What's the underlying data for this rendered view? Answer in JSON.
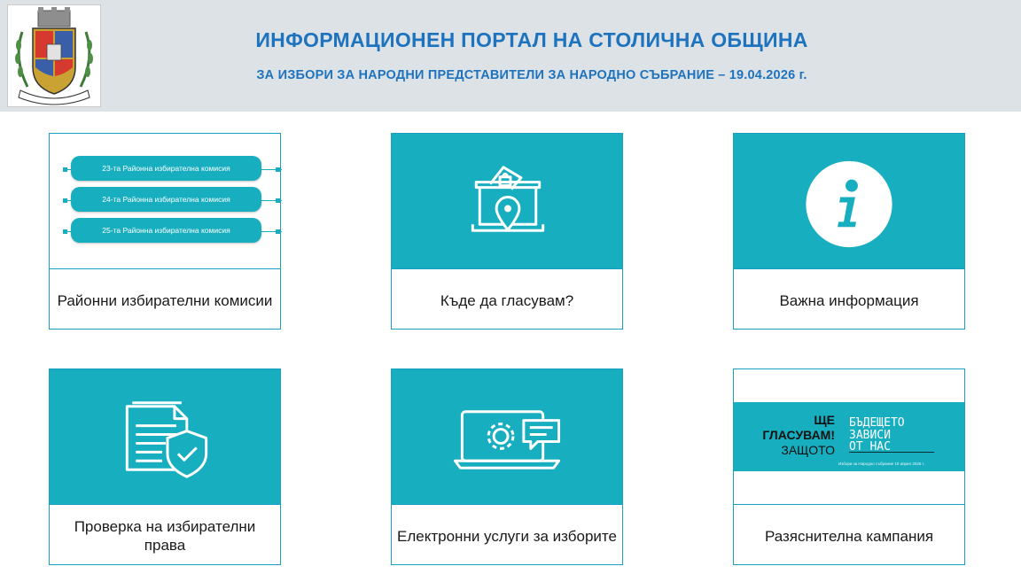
{
  "header": {
    "title": "ИНФОРМАЦИОНЕН ПОРТАЛ НА СТОЛИЧНА ОБЩИНА",
    "subtitle": "ЗА ИЗБОРИ ЗА НАРОДНИ ПРЕДСТАВИТЕЛИ ЗА НАРОДНО СЪБРАНИЕ – 19.04.2026 г.",
    "crest_motto": "РАСТЕ НО НЕ СТАРЕЕ"
  },
  "cards": [
    {
      "label": "Районни избирателни комисии",
      "commissions": [
        "23-та Районна избирателна комисия",
        "24-та Районна избирателна комисия",
        "25-та Районна избирателна комисия"
      ]
    },
    {
      "label": "Къде да гласувам?",
      "icon": "ballot-box-location-icon"
    },
    {
      "label": "Важна информация",
      "icon": "info-icon"
    },
    {
      "label": "Проверка на избирателни права",
      "icon": "document-shield-icon"
    },
    {
      "label": "Електронни услуги за изборите",
      "icon": "laptop-gear-chat-icon"
    },
    {
      "label": "Разяснителна кампания",
      "banner": {
        "left_lines": [
          "ЩЕ",
          "ГЛАСУВАМ!",
          "ЗАЩОТО"
        ],
        "right_lines": [
          "БЪДЕЩЕТО",
          "ЗАВИСИ",
          "ОТ НАС"
        ],
        "small": "Избори за Народно събрание 19 април 2026 г."
      }
    }
  ],
  "colors": {
    "accent": "#17aebf",
    "title": "#1e73be",
    "header_bg": "#dde2e6"
  }
}
